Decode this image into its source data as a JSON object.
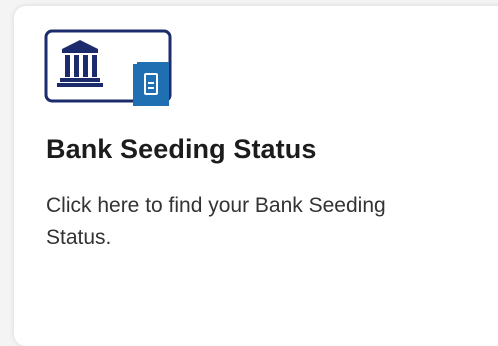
{
  "card": {
    "title": "Bank Seeding Status",
    "description": "Click here to find your Bank Seeding Status.",
    "icon": "bank-building-with-card-icon"
  },
  "colors": {
    "icon_outline": "#1c2b6b",
    "icon_accent": "#1f6fb3",
    "title": "#1c1c1c",
    "text": "#333333"
  }
}
